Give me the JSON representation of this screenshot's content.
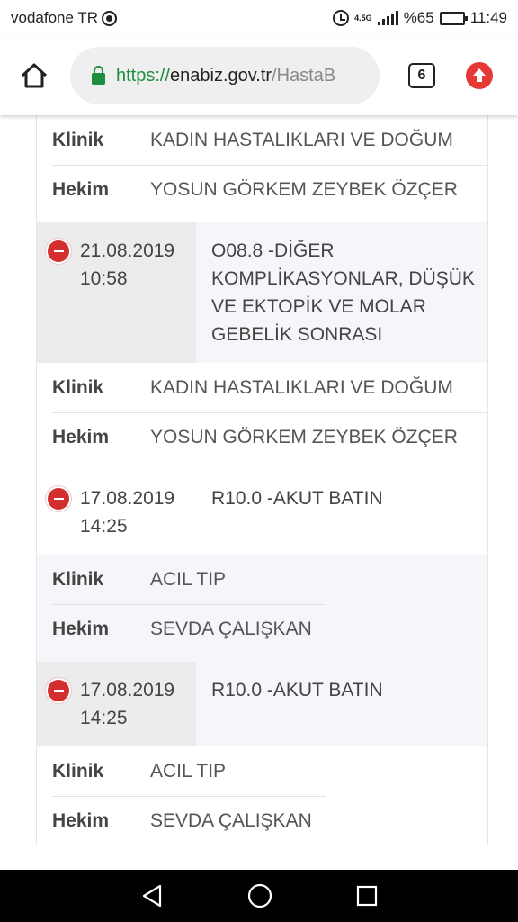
{
  "status_bar": {
    "carrier": "vodafone TR",
    "network": "4.5G",
    "battery": "%65",
    "battery_level": 0.65,
    "time": "11:49"
  },
  "browser": {
    "url_scheme": "https://",
    "url_host": "enabiz.gov.tr",
    "url_path": "/HastaB",
    "tab_count": "6"
  },
  "labels": {
    "clinic": "Klinik",
    "doctor": "Hekim"
  },
  "records": [
    {
      "clinic": "KADIN HASTALIKLARI VE DOĞUM",
      "doctor": "YOSUN GÖRKEM ZEYBEK ÖZÇER"
    },
    {
      "date": "21.08.2019",
      "time": "10:58",
      "diagnosis": "O08.8 -DİĞER KOMPLİKASYONLAR, DÜŞÜK VE EKTOPİK VE MOLAR GEBELİK SONRASI",
      "clinic": "KADIN HASTALIKLARI VE DOĞUM",
      "doctor": "YOSUN GÖRKEM ZEYBEK ÖZÇER"
    },
    {
      "date": "17.08.2019",
      "time": "14:25",
      "diagnosis": "R10.0 -AKUT BATIN",
      "clinic": "ACIL TIP",
      "doctor": "SEVDA ÇALIŞKAN"
    },
    {
      "date": "17.08.2019",
      "time": "14:25",
      "diagnosis": "R10.0 -AKUT BATIN",
      "clinic": "ACIL TIP",
      "doctor": "SEVDA ÇALIŞKAN"
    }
  ],
  "colors": {
    "accent_green": "#1e8e3e",
    "remove_red": "#d32f2f",
    "update_red": "#e53935"
  }
}
